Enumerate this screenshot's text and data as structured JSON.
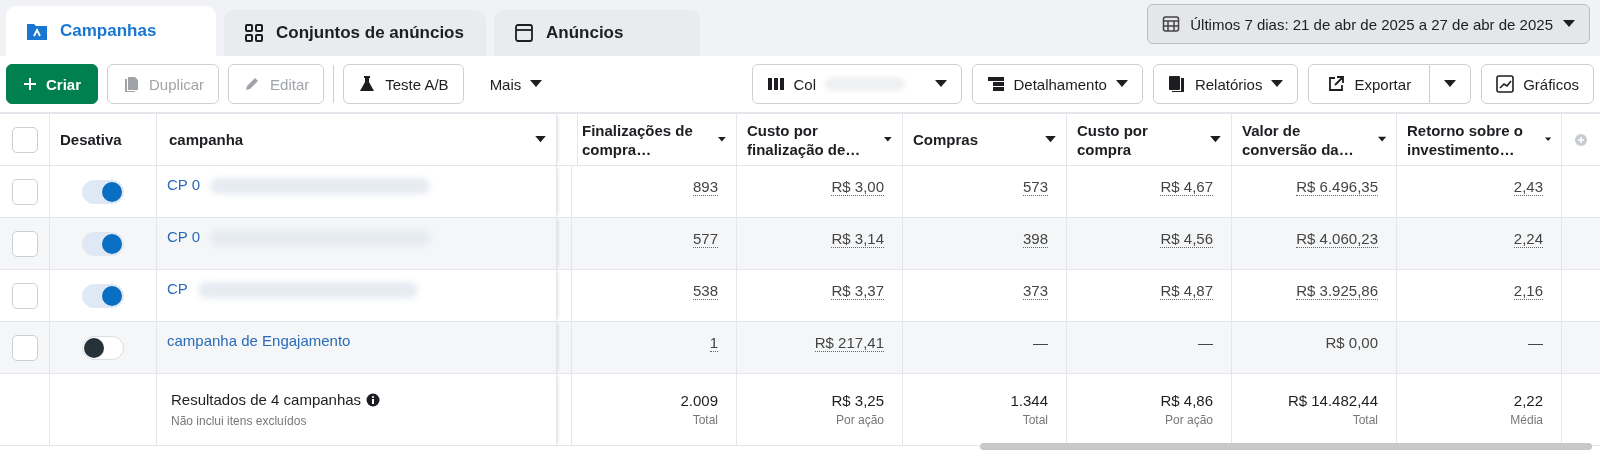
{
  "tabs": [
    {
      "label": "Campanhas",
      "selected": true
    },
    {
      "label": "Conjuntos de anúncios",
      "selected": false
    },
    {
      "label": "Anúncios",
      "selected": false
    }
  ],
  "date_range": "Últimos 7 dias: 21 de abr de 2025 a 27 de abr de 2025",
  "toolbar": [
    {
      "label": "Criar",
      "kind": "primary",
      "disabled": false
    },
    {
      "label": "Duplicar",
      "kind": "normal",
      "disabled": true
    },
    {
      "label": "Editar",
      "kind": "normal",
      "disabled": true
    },
    {
      "label": "Teste A/B",
      "kind": "normal",
      "disabled": false
    },
    {
      "label": "Mais",
      "kind": "menu",
      "disabled": false
    }
  ],
  "toolbar_right": [
    {
      "label": "Col",
      "kind": "dropdown"
    },
    {
      "label": "Detalhamento",
      "kind": "dropdown"
    },
    {
      "label": "Relatórios",
      "kind": "dropdown"
    },
    {
      "label": "Exportar",
      "kind": "split"
    },
    {
      "label": "Gráficos",
      "kind": "plain"
    }
  ],
  "table": {
    "select_all_checked": false,
    "columns": [
      "Desativa",
      "campanha",
      "Finalizações de compra…",
      "Custo por finalização de…",
      "Compras",
      "Custo por compra",
      "Valor de conversão da…",
      "Retorno sobre o investimento…"
    ],
    "rows": [
      {
        "checked": false,
        "on": true,
        "name": "CP 0",
        "redacted": true,
        "cells": [
          "893",
          "R$ 3,00",
          "573",
          "R$ 4,67",
          "R$ 6.496,35",
          "2,43"
        ]
      },
      {
        "checked": false,
        "on": true,
        "name": "CP 0",
        "redacted": true,
        "cells": [
          "577",
          "R$ 3,14",
          "398",
          "R$ 4,56",
          "R$ 4.060,23",
          "2,24"
        ]
      },
      {
        "checked": false,
        "on": true,
        "name": "CP",
        "redacted": true,
        "cells": [
          "538",
          "R$ 3,37",
          "373",
          "R$ 4,87",
          "R$ 3.925,86",
          "2,16"
        ]
      },
      {
        "checked": false,
        "on": false,
        "name": "campanha de Engajamento",
        "redacted": false,
        "cells": [
          "1",
          "R$ 217,41",
          "—",
          "—",
          "R$ 0,00",
          "—"
        ]
      }
    ],
    "totals": {
      "label": "Resultados de 4 campanhas",
      "note": "Não inclui itens excluídos",
      "cells": [
        {
          "value": "2.009",
          "sub": "Total"
        },
        {
          "value": "R$ 3,25",
          "sub": "Por ação"
        },
        {
          "value": "1.344",
          "sub": "Total"
        },
        {
          "value": "R$ 4,86",
          "sub": "Por ação"
        },
        {
          "value": "R$ 14.482,44",
          "sub": "Total"
        },
        {
          "value": "2,22",
          "sub": "Média"
        }
      ]
    }
  }
}
